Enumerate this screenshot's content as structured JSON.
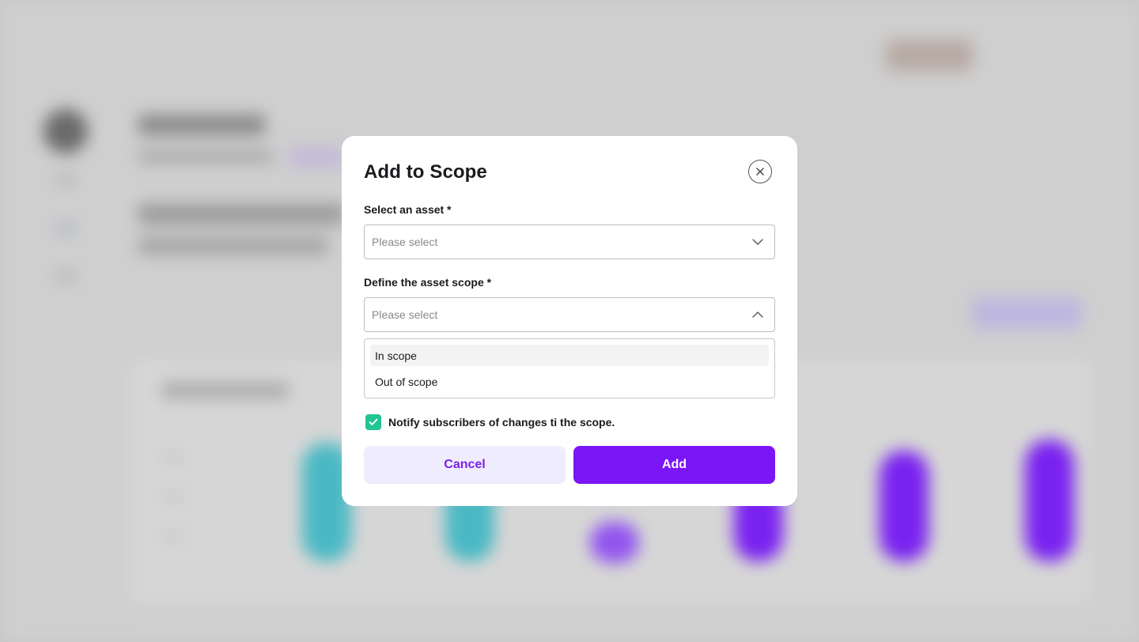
{
  "modal": {
    "title": "Add to Scope",
    "asset_field": {
      "label": "Select an asset *",
      "placeholder": "Please select"
    },
    "scope_field": {
      "label": "Define the asset scope *",
      "placeholder": "Please select",
      "expanded": true,
      "options": [
        "In scope",
        "Out of scope"
      ],
      "highlighted_option": "In scope"
    },
    "notify": {
      "label": "Notify subscribers of changes ti the scope.",
      "checked": true
    },
    "buttons": {
      "cancel": "Cancel",
      "add": "Add"
    }
  },
  "colors": {
    "accent": "#7a16f5",
    "accent_soft": "#efedfd",
    "checkbox": "#22c493",
    "overlay": "#c8c8c8"
  },
  "icons": [
    "close-icon",
    "chevron-down-icon",
    "chevron-up-icon",
    "check-icon"
  ]
}
